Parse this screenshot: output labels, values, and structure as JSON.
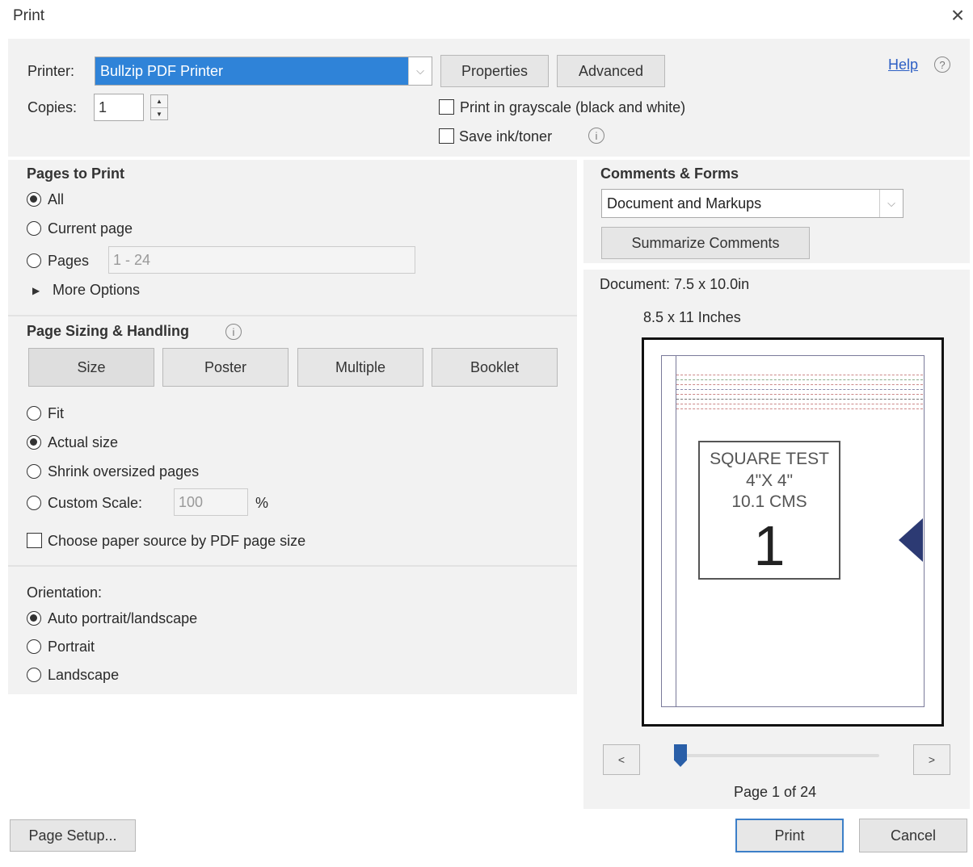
{
  "dialog": {
    "title": "Print"
  },
  "printer": {
    "label": "Printer:",
    "selected": "Bullzip PDF Printer",
    "properties_label": "Properties",
    "advanced_label": "Advanced",
    "help_label": "Help"
  },
  "copies": {
    "label": "Copies:",
    "value": "1"
  },
  "options": {
    "grayscale_label": "Print in grayscale (black and white)",
    "save_ink_label": "Save ink/toner"
  },
  "pages_to_print": {
    "title": "Pages to Print",
    "all_label": "All",
    "current_label": "Current page",
    "pages_label": "Pages",
    "pages_range": "1 - 24",
    "more_options_label": "More Options"
  },
  "sizing": {
    "title": "Page Sizing & Handling",
    "tabs": [
      "Size",
      "Poster",
      "Multiple",
      "Booklet"
    ],
    "fit_label": "Fit",
    "actual_label": "Actual size",
    "shrink_label": "Shrink oversized pages",
    "custom_label": "Custom Scale:",
    "custom_value": "100",
    "percent": "%",
    "paper_source_label": "Choose paper source by PDF page size"
  },
  "orientation": {
    "title": "Orientation:",
    "auto_label": "Auto portrait/landscape",
    "portrait_label": "Portrait",
    "landscape_label": "Landscape"
  },
  "comments": {
    "title": "Comments & Forms",
    "selected": "Document and Markups",
    "summarize_label": "Summarize Comments"
  },
  "preview": {
    "document_size": "Document: 7.5 x 10.0in",
    "paper_size": "8.5 x 11 Inches",
    "content_line1": "SQUARE TEST",
    "content_line2": "4\"X 4\"",
    "content_line3": "10.1 CMS",
    "content_number": "1",
    "prev_label": "<",
    "next_label": ">",
    "page_indicator": "Page 1 of 24",
    "current_page": 1,
    "total_pages": 24
  },
  "footer": {
    "page_setup_label": "Page Setup...",
    "print_label": "Print",
    "cancel_label": "Cancel"
  },
  "colors": {
    "accent": "#2f83d8",
    "marker": "#2c3a73",
    "slider": "#2a5fa8"
  }
}
